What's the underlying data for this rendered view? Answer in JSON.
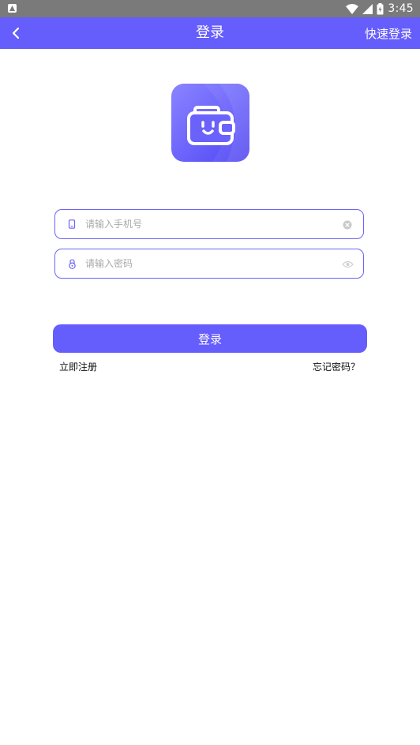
{
  "status_bar": {
    "time": "3:45",
    "icons": [
      "notification-icon",
      "wifi-icon",
      "signal-icon",
      "battery-icon"
    ]
  },
  "nav": {
    "back_icon": "chevron-left-icon",
    "title": "登录",
    "action": "快速登录"
  },
  "logo": {
    "icon": "wallet-smile-icon"
  },
  "form": {
    "phone": {
      "placeholder": "请输入手机号",
      "value": "",
      "icon": "phone-icon",
      "trailing_icon": "clear-icon"
    },
    "password": {
      "placeholder": "请输入密码",
      "value": "",
      "icon": "lock-icon",
      "trailing_icon": "eye-icon"
    },
    "submit_label": "登录"
  },
  "links": {
    "register": "立即注册",
    "forgot": "忘记密码？"
  },
  "colors": {
    "primary": "#665dfd",
    "status_bar": "#7a7a7a",
    "placeholder": "#a9a9a9"
  }
}
